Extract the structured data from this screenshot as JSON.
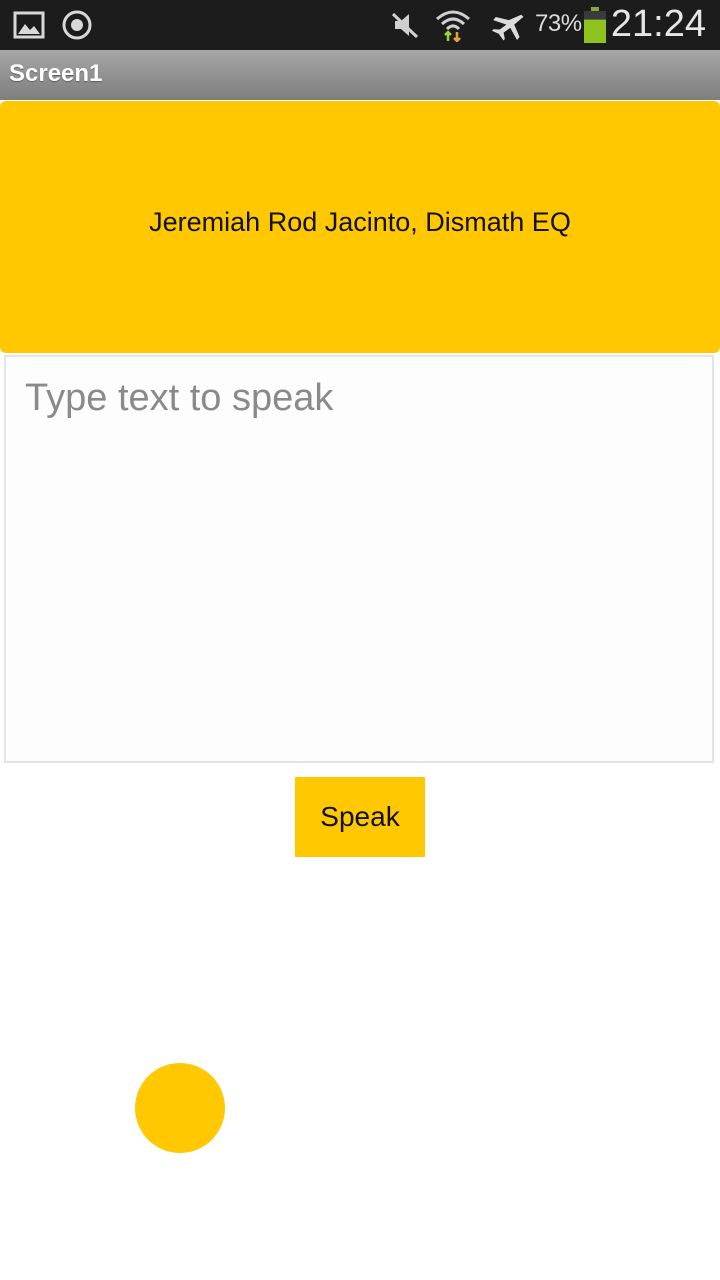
{
  "status_bar": {
    "battery_percent": "73%",
    "battery_level": 0.73,
    "time": "21:24",
    "icons": [
      "gallery-icon",
      "sync-icon",
      "mute-icon",
      "wifi-icon",
      "airplane-mode-icon",
      "battery-icon"
    ]
  },
  "title_bar": {
    "title": "Screen1"
  },
  "banner": {
    "text": "Jeremiah Rod Jacinto, Dismath EQ"
  },
  "input": {
    "placeholder": "Type text to speak",
    "value": ""
  },
  "speak_button": {
    "label": "Speak"
  },
  "colors": {
    "accent": "#ffc800",
    "status_bar": "#1c1c1c",
    "title_bar": "#8f8f8f",
    "background": "#ffffff"
  }
}
